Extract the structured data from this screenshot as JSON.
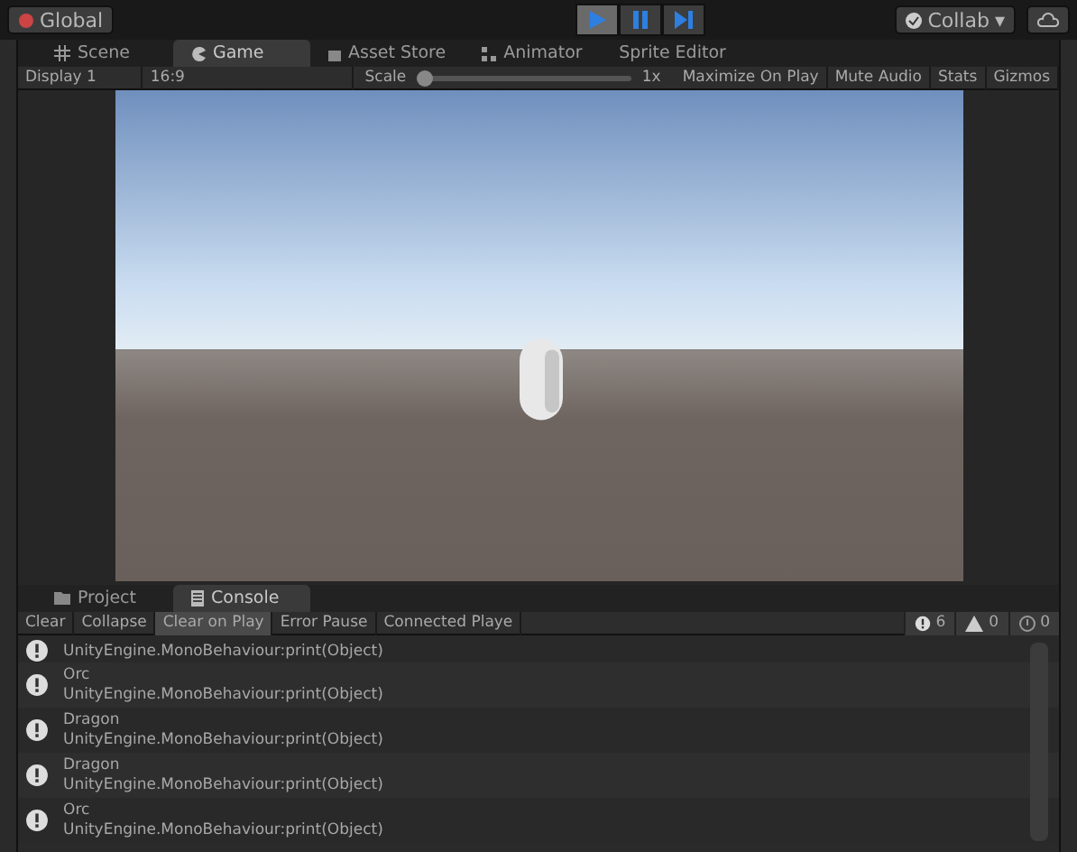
{
  "toolbar": {
    "pivot": "Global",
    "play_controls": [
      {
        "kind": "play",
        "selected": true
      },
      {
        "kind": "pause",
        "selected": false
      },
      {
        "kind": "step",
        "selected": false
      }
    ],
    "collab": "Collab",
    "collab_caret": "▾"
  },
  "tabs": [
    {
      "label": "Scene",
      "kind": "scene",
      "selected": false
    },
    {
      "label": "Game",
      "kind": "game",
      "selected": true
    },
    {
      "label": "Asset Store",
      "kind": "store",
      "selected": false
    },
    {
      "label": "Animator",
      "kind": "animator",
      "selected": false
    },
    {
      "label": "Sprite Editor",
      "kind": "none",
      "selected": false
    }
  ],
  "game_bar": {
    "display": "Display 1",
    "aspect": "16:9",
    "scale_label": "Scale",
    "scale_value": "1x",
    "scale": {
      "level": 0.0
    },
    "buttons": [
      {
        "label": "Maximize On Play",
        "selected": false
      },
      {
        "label": "Mute Audio",
        "selected": false
      },
      {
        "label": "Stats",
        "selected": false
      },
      {
        "label": "Gizmos",
        "selected": false
      }
    ]
  },
  "console_tabs": [
    {
      "label": "Project",
      "kind": "folder",
      "selected": false
    },
    {
      "label": "Console",
      "kind": "console",
      "selected": true
    }
  ],
  "console_bar": {
    "buttons": [
      {
        "label": "Clear",
        "selected": false
      },
      {
        "label": "Collapse",
        "selected": false
      },
      {
        "label": "Clear on Play",
        "selected": true
      },
      {
        "label": "Error Pause",
        "selected": false
      },
      {
        "label": "Connected Playe",
        "selected": false
      }
    ],
    "counts": [
      {
        "kind": "info",
        "value": "6"
      },
      {
        "kind": "warning",
        "value": "0"
      },
      {
        "kind": "error",
        "value": "0"
      }
    ]
  },
  "log": [
    {
      "detail": "UnityEngine.MonoBehaviour:print(Object)"
    },
    {
      "message": "Orc",
      "detail": "UnityEngine.MonoBehaviour:print(Object)"
    },
    {
      "message": "Dragon",
      "detail": "UnityEngine.MonoBehaviour:print(Object)"
    },
    {
      "message": "Dragon",
      "detail": "UnityEngine.MonoBehaviour:print(Object)"
    },
    {
      "message": "Orc",
      "detail": "UnityEngine.MonoBehaviour:print(Object)"
    }
  ]
}
